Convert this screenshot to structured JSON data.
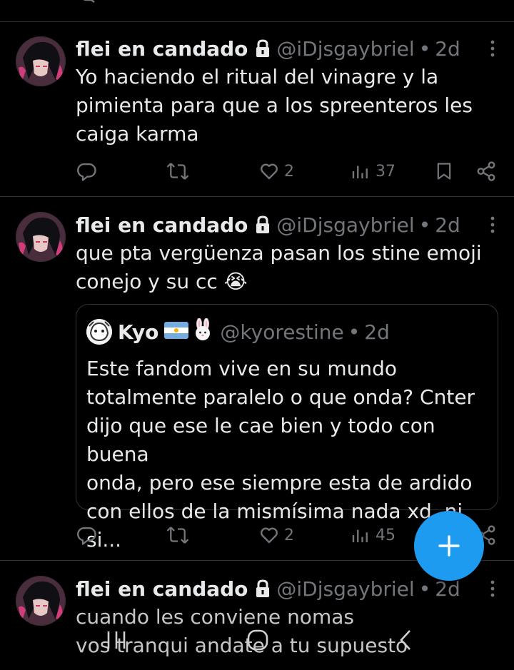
{
  "colors": {
    "background": "#000000",
    "text": "#e7e9ea",
    "muted": "#71767b",
    "divider": "#2f3336",
    "accent": "#1d9bf0"
  },
  "tweets": [
    {
      "name": "flei en candado",
      "handle": "@iDjsgaybriel",
      "time": "2d",
      "text": "Yo haciendo el ritual del vinagre y la\npimienta para que a los spreenteros les\ncaiga karma",
      "likes": "2",
      "views": "37"
    },
    {
      "name": "flei en candado",
      "handle": "@iDjsgaybriel",
      "time": "2d",
      "text": "que pta vergüenza pasan los stine emoji\nconejo y su cc 😭",
      "likes": "2",
      "views": "45",
      "quote": {
        "name": "Kyo",
        "handle": "@kyorestine",
        "time": "2d",
        "text": "Este fandom vive en su mundo\ntotalmente paralelo o que onda? Cnter\ndijo que ese le cae bien y todo con buena\nonda, pero ese siempre esta de ardido\ncon ellos de la mismísima nada xd, ni si..."
      }
    },
    {
      "name": "flei en candado",
      "handle": "@iDjsgaybriel",
      "time": "2d",
      "text": "cuando les conviene nomas\nvos tranqui andate a tu supuesto"
    }
  ],
  "separator": "•",
  "icons": {
    "reply": "reply-icon",
    "retweet": "retweet-icon",
    "like": "heart-icon",
    "views": "views-icon",
    "bookmark": "bookmark-icon",
    "share": "share-icon",
    "more": "more-icon",
    "lock": "lock-icon",
    "compose": "plus-icon"
  }
}
